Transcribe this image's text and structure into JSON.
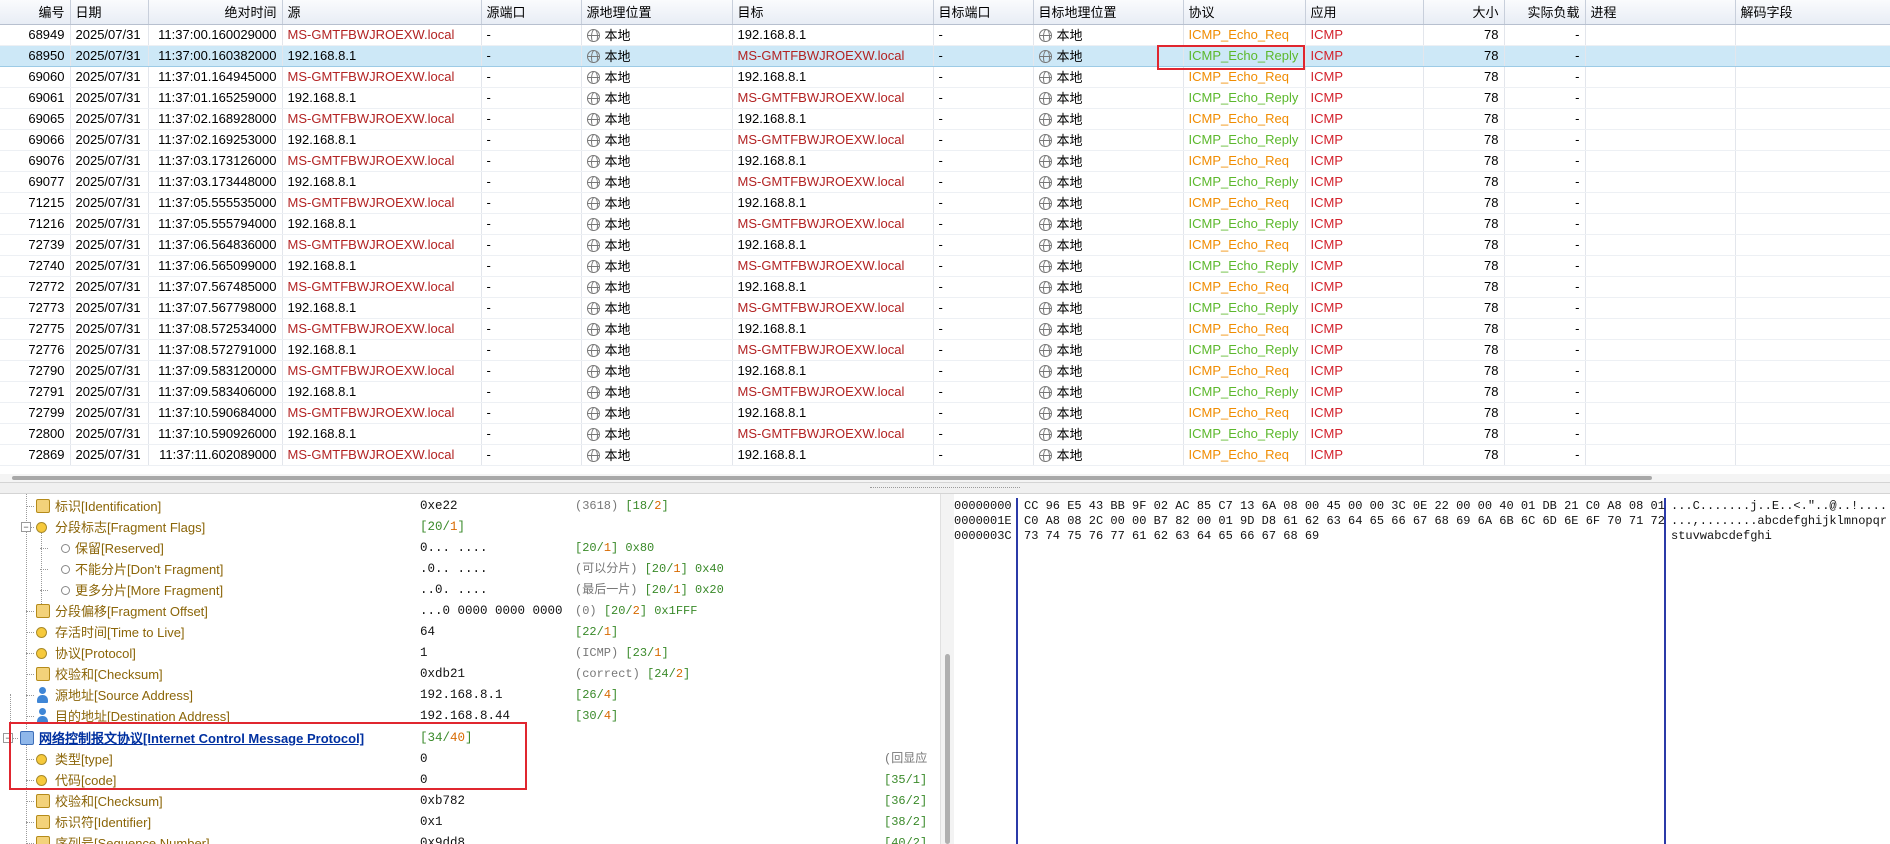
{
  "packet_list": {
    "columns": [
      "编号",
      "日期",
      "绝对时间",
      "源",
      "源端口",
      "源地理位置",
      "目标",
      "目标端口",
      "目标地理位置",
      "协议",
      "应用",
      "大小",
      "实际负载",
      "进程",
      "解码字段"
    ],
    "rows": [
      {
        "no": "68949",
        "date": "2025/07/31",
        "time": "11:37:00.160029000",
        "src": "MS-GMTFBWJROEXW.local",
        "sport": "-",
        "sgeo": "本地",
        "dst": "192.168.8.1",
        "dport": "-",
        "dgeo": "本地",
        "proto": "ICMP_Echo_Req",
        "app": "ICMP",
        "size": "78",
        "payload": "-",
        "selected": false
      },
      {
        "no": "68950",
        "date": "2025/07/31",
        "time": "11:37:00.160382000",
        "src": "192.168.8.1",
        "sport": "-",
        "sgeo": "本地",
        "dst": "MS-GMTFBWJROEXW.local",
        "dport": "-",
        "dgeo": "本地",
        "proto": "ICMP_Echo_Reply",
        "app": "ICMP",
        "size": "78",
        "payload": "-",
        "selected": true
      },
      {
        "no": "69060",
        "date": "2025/07/31",
        "time": "11:37:01.164945000",
        "src": "MS-GMTFBWJROEXW.local",
        "sport": "-",
        "sgeo": "本地",
        "dst": "192.168.8.1",
        "dport": "-",
        "dgeo": "本地",
        "proto": "ICMP_Echo_Req",
        "app": "ICMP",
        "size": "78",
        "payload": "-",
        "selected": false
      },
      {
        "no": "69061",
        "date": "2025/07/31",
        "time": "11:37:01.165259000",
        "src": "192.168.8.1",
        "sport": "-",
        "sgeo": "本地",
        "dst": "MS-GMTFBWJROEXW.local",
        "dport": "-",
        "dgeo": "本地",
        "proto": "ICMP_Echo_Reply",
        "app": "ICMP",
        "size": "78",
        "payload": "-",
        "selected": false
      },
      {
        "no": "69065",
        "date": "2025/07/31",
        "time": "11:37:02.168928000",
        "src": "MS-GMTFBWJROEXW.local",
        "sport": "-",
        "sgeo": "本地",
        "dst": "192.168.8.1",
        "dport": "-",
        "dgeo": "本地",
        "proto": "ICMP_Echo_Req",
        "app": "ICMP",
        "size": "78",
        "payload": "-",
        "selected": false
      },
      {
        "no": "69066",
        "date": "2025/07/31",
        "time": "11:37:02.169253000",
        "src": "192.168.8.1",
        "sport": "-",
        "sgeo": "本地",
        "dst": "MS-GMTFBWJROEXW.local",
        "dport": "-",
        "dgeo": "本地",
        "proto": "ICMP_Echo_Reply",
        "app": "ICMP",
        "size": "78",
        "payload": "-",
        "selected": false
      },
      {
        "no": "69076",
        "date": "2025/07/31",
        "time": "11:37:03.173126000",
        "src": "MS-GMTFBWJROEXW.local",
        "sport": "-",
        "sgeo": "本地",
        "dst": "192.168.8.1",
        "dport": "-",
        "dgeo": "本地",
        "proto": "ICMP_Echo_Req",
        "app": "ICMP",
        "size": "78",
        "payload": "-",
        "selected": false
      },
      {
        "no": "69077",
        "date": "2025/07/31",
        "time": "11:37:03.173448000",
        "src": "192.168.8.1",
        "sport": "-",
        "sgeo": "本地",
        "dst": "MS-GMTFBWJROEXW.local",
        "dport": "-",
        "dgeo": "本地",
        "proto": "ICMP_Echo_Reply",
        "app": "ICMP",
        "size": "78",
        "payload": "-",
        "selected": false
      },
      {
        "no": "71215",
        "date": "2025/07/31",
        "time": "11:37:05.555535000",
        "src": "MS-GMTFBWJROEXW.local",
        "sport": "-",
        "sgeo": "本地",
        "dst": "192.168.8.1",
        "dport": "-",
        "dgeo": "本地",
        "proto": "ICMP_Echo_Req",
        "app": "ICMP",
        "size": "78",
        "payload": "-",
        "selected": false
      },
      {
        "no": "71216",
        "date": "2025/07/31",
        "time": "11:37:05.555794000",
        "src": "192.168.8.1",
        "sport": "-",
        "sgeo": "本地",
        "dst": "MS-GMTFBWJROEXW.local",
        "dport": "-",
        "dgeo": "本地",
        "proto": "ICMP_Echo_Reply",
        "app": "ICMP",
        "size": "78",
        "payload": "-",
        "selected": false
      },
      {
        "no": "72739",
        "date": "2025/07/31",
        "time": "11:37:06.564836000",
        "src": "MS-GMTFBWJROEXW.local",
        "sport": "-",
        "sgeo": "本地",
        "dst": "192.168.8.1",
        "dport": "-",
        "dgeo": "本地",
        "proto": "ICMP_Echo_Req",
        "app": "ICMP",
        "size": "78",
        "payload": "-",
        "selected": false
      },
      {
        "no": "72740",
        "date": "2025/07/31",
        "time": "11:37:06.565099000",
        "src": "192.168.8.1",
        "sport": "-",
        "sgeo": "本地",
        "dst": "MS-GMTFBWJROEXW.local",
        "dport": "-",
        "dgeo": "本地",
        "proto": "ICMP_Echo_Reply",
        "app": "ICMP",
        "size": "78",
        "payload": "-",
        "selected": false
      },
      {
        "no": "72772",
        "date": "2025/07/31",
        "time": "11:37:07.567485000",
        "src": "MS-GMTFBWJROEXW.local",
        "sport": "-",
        "sgeo": "本地",
        "dst": "192.168.8.1",
        "dport": "-",
        "dgeo": "本地",
        "proto": "ICMP_Echo_Req",
        "app": "ICMP",
        "size": "78",
        "payload": "-",
        "selected": false
      },
      {
        "no": "72773",
        "date": "2025/07/31",
        "time": "11:37:07.567798000",
        "src": "192.168.8.1",
        "sport": "-",
        "sgeo": "本地",
        "dst": "MS-GMTFBWJROEXW.local",
        "dport": "-",
        "dgeo": "本地",
        "proto": "ICMP_Echo_Reply",
        "app": "ICMP",
        "size": "78",
        "payload": "-",
        "selected": false
      },
      {
        "no": "72775",
        "date": "2025/07/31",
        "time": "11:37:08.572534000",
        "src": "MS-GMTFBWJROEXW.local",
        "sport": "-",
        "sgeo": "本地",
        "dst": "192.168.8.1",
        "dport": "-",
        "dgeo": "本地",
        "proto": "ICMP_Echo_Req",
        "app": "ICMP",
        "size": "78",
        "payload": "-",
        "selected": false
      },
      {
        "no": "72776",
        "date": "2025/07/31",
        "time": "11:37:08.572791000",
        "src": "192.168.8.1",
        "sport": "-",
        "sgeo": "本地",
        "dst": "MS-GMTFBWJROEXW.local",
        "dport": "-",
        "dgeo": "本地",
        "proto": "ICMP_Echo_Reply",
        "app": "ICMP",
        "size": "78",
        "payload": "-",
        "selected": false
      },
      {
        "no": "72790",
        "date": "2025/07/31",
        "time": "11:37:09.583120000",
        "src": "MS-GMTFBWJROEXW.local",
        "sport": "-",
        "sgeo": "本地",
        "dst": "192.168.8.1",
        "dport": "-",
        "dgeo": "本地",
        "proto": "ICMP_Echo_Req",
        "app": "ICMP",
        "size": "78",
        "payload": "-",
        "selected": false
      },
      {
        "no": "72791",
        "date": "2025/07/31",
        "time": "11:37:09.583406000",
        "src": "192.168.8.1",
        "sport": "-",
        "sgeo": "本地",
        "dst": "MS-GMTFBWJROEXW.local",
        "dport": "-",
        "dgeo": "本地",
        "proto": "ICMP_Echo_Reply",
        "app": "ICMP",
        "size": "78",
        "payload": "-",
        "selected": false
      },
      {
        "no": "72799",
        "date": "2025/07/31",
        "time": "11:37:10.590684000",
        "src": "MS-GMTFBWJROEXW.local",
        "sport": "-",
        "sgeo": "本地",
        "dst": "192.168.8.1",
        "dport": "-",
        "dgeo": "本地",
        "proto": "ICMP_Echo_Req",
        "app": "ICMP",
        "size": "78",
        "payload": "-",
        "selected": false
      },
      {
        "no": "72800",
        "date": "2025/07/31",
        "time": "11:37:10.590926000",
        "src": "192.168.8.1",
        "sport": "-",
        "sgeo": "本地",
        "dst": "MS-GMTFBWJROEXW.local",
        "dport": "-",
        "dgeo": "本地",
        "proto": "ICMP_Echo_Reply",
        "app": "ICMP",
        "size": "78",
        "payload": "-",
        "selected": false
      },
      {
        "no": "72869",
        "date": "2025/07/31",
        "time": "11:37:11.602089000",
        "src": "MS-GMTFBWJROEXW.local",
        "sport": "-",
        "sgeo": "本地",
        "dst": "192.168.8.1",
        "dport": "-",
        "dgeo": "本地",
        "proto": "ICMP_Echo_Req",
        "app": "ICMP",
        "size": "78",
        "payload": "-",
        "selected": false
      }
    ]
  },
  "decode_tree": {
    "rows": [
      {
        "name": "标识[Identification]",
        "value": "0xe22",
        "info": [
          [
            "gray",
            "(3618)  "
          ],
          [
            "grn",
            "[18/"
          ],
          [
            "org",
            "2"
          ],
          [
            "grn",
            "]"
          ]
        ]
      },
      {
        "name": "分段标志[Fragment Flags]",
        "value": "",
        "info": [],
        "value_info": [
          [
            "grn",
            "[20/"
          ],
          [
            "org",
            "1"
          ],
          [
            "grn",
            "]"
          ]
        ]
      },
      {
        "name": "保留[Reserved]",
        "value": "0... ....",
        "info": [
          [
            "grn",
            "[20/"
          ],
          [
            "org",
            "1"
          ],
          [
            "grn",
            "]  0x80"
          ]
        ]
      },
      {
        "name": "不能分片[Don't Fragment]",
        "value": ".0.. ....",
        "info": [
          [
            "gray",
            "(可以分片)  "
          ],
          [
            "grn",
            "[20/"
          ],
          [
            "org",
            "1"
          ],
          [
            "grn",
            "]  0x40"
          ]
        ]
      },
      {
        "name": "更多分片[More Fragment]",
        "value": "..0. ....",
        "info": [
          [
            "gray",
            "(最后一片)  "
          ],
          [
            "grn",
            "[20/"
          ],
          [
            "org",
            "1"
          ],
          [
            "grn",
            "]  0x20"
          ]
        ]
      },
      {
        "name": "分段偏移[Fragment Offset]",
        "value": "...0 0000 0000 0000",
        "info": [
          [
            "gray",
            "(0)  "
          ],
          [
            "grn",
            "[20/"
          ],
          [
            "org",
            "2"
          ],
          [
            "grn",
            "]  0x1FFF"
          ]
        ]
      },
      {
        "name": "存活时间[Time to Live]",
        "value": "64",
        "info": [
          [
            "grn",
            "[22/"
          ],
          [
            "org",
            "1"
          ],
          [
            "grn",
            "]"
          ]
        ]
      },
      {
        "name": "协议[Protocol]",
        "value": "1",
        "info": [
          [
            "gray",
            "(ICMP)  "
          ],
          [
            "grn",
            "[23/"
          ],
          [
            "org",
            "1"
          ],
          [
            "grn",
            "]"
          ]
        ]
      },
      {
        "name": "校验和[Checksum]",
        "value": "0xdb21",
        "info": [
          [
            "gray",
            "(correct)  "
          ],
          [
            "grn",
            "[24/"
          ],
          [
            "org",
            "2"
          ],
          [
            "grn",
            "]"
          ]
        ]
      },
      {
        "name": "源地址[Source Address]",
        "value": "192.168.8.1",
        "info": [
          [
            "grn",
            "[26/"
          ],
          [
            "org",
            "4"
          ],
          [
            "grn",
            "]"
          ]
        ]
      },
      {
        "name": "目的地址[Destination Address]",
        "value": "192.168.8.44",
        "info": [
          [
            "grn",
            "[30/"
          ],
          [
            "org",
            "4"
          ],
          [
            "grn",
            "]"
          ]
        ]
      },
      {
        "name": "网络控制报文协议[Internet Control Message Protocol]",
        "value": "",
        "info": [],
        "value_info": [
          [
            "grn",
            "[34/"
          ],
          [
            "org",
            "40"
          ],
          [
            "grn",
            "]"
          ]
        ]
      },
      {
        "name": "类型[type]",
        "value": "0",
        "info": [],
        "right_info": "(回显应"
      },
      {
        "name": "代码[code]",
        "value": "0",
        "info": [],
        "right_info": "[35/1]"
      },
      {
        "name": "校验和[Checksum]",
        "value": "0xb782",
        "info": [],
        "right_info": "[36/2]"
      },
      {
        "name": "标识符[Identifier]",
        "value": "0x1",
        "info": [],
        "right_info": "[38/2]"
      },
      {
        "name": "序列号[Sequence Number]",
        "value": "0x9dd8",
        "info": [],
        "right_info": "[40/2]"
      }
    ]
  },
  "hex_view": {
    "lines": [
      {
        "offset": "00000000",
        "hex": "CC 96 E5 43 BB 9F 02 AC 85 C7 13 6A 08 00 45 00 00 3C 0E 22 00 00 40 01 DB 21 C0 A8 08 01",
        "ascii": "...C.......j..E..<.\"..@..!...."
      },
      {
        "offset": "0000001E",
        "hex": "C0 A8 08 2C 00 00 B7 82 00 01 9D D8 61 62 63 64 65 66 67 68 69 6A 6B 6C 6D 6E 6F 70 71 72",
        "ascii": "...,........abcdefghijklmnopqr"
      },
      {
        "offset": "0000003C",
        "hex": "73 74 75 76 77 61 62 63 64 65 66 67 68 69",
        "ascii": "stuvwabcdefghi"
      }
    ]
  },
  "colors": {
    "host": "#b22222",
    "echo_req": "#f08c00",
    "echo_reply": "#5cb82c",
    "app_icmp": "#d31f2a",
    "selection": "#cde8f7",
    "highlight_box": "#e0262f"
  }
}
